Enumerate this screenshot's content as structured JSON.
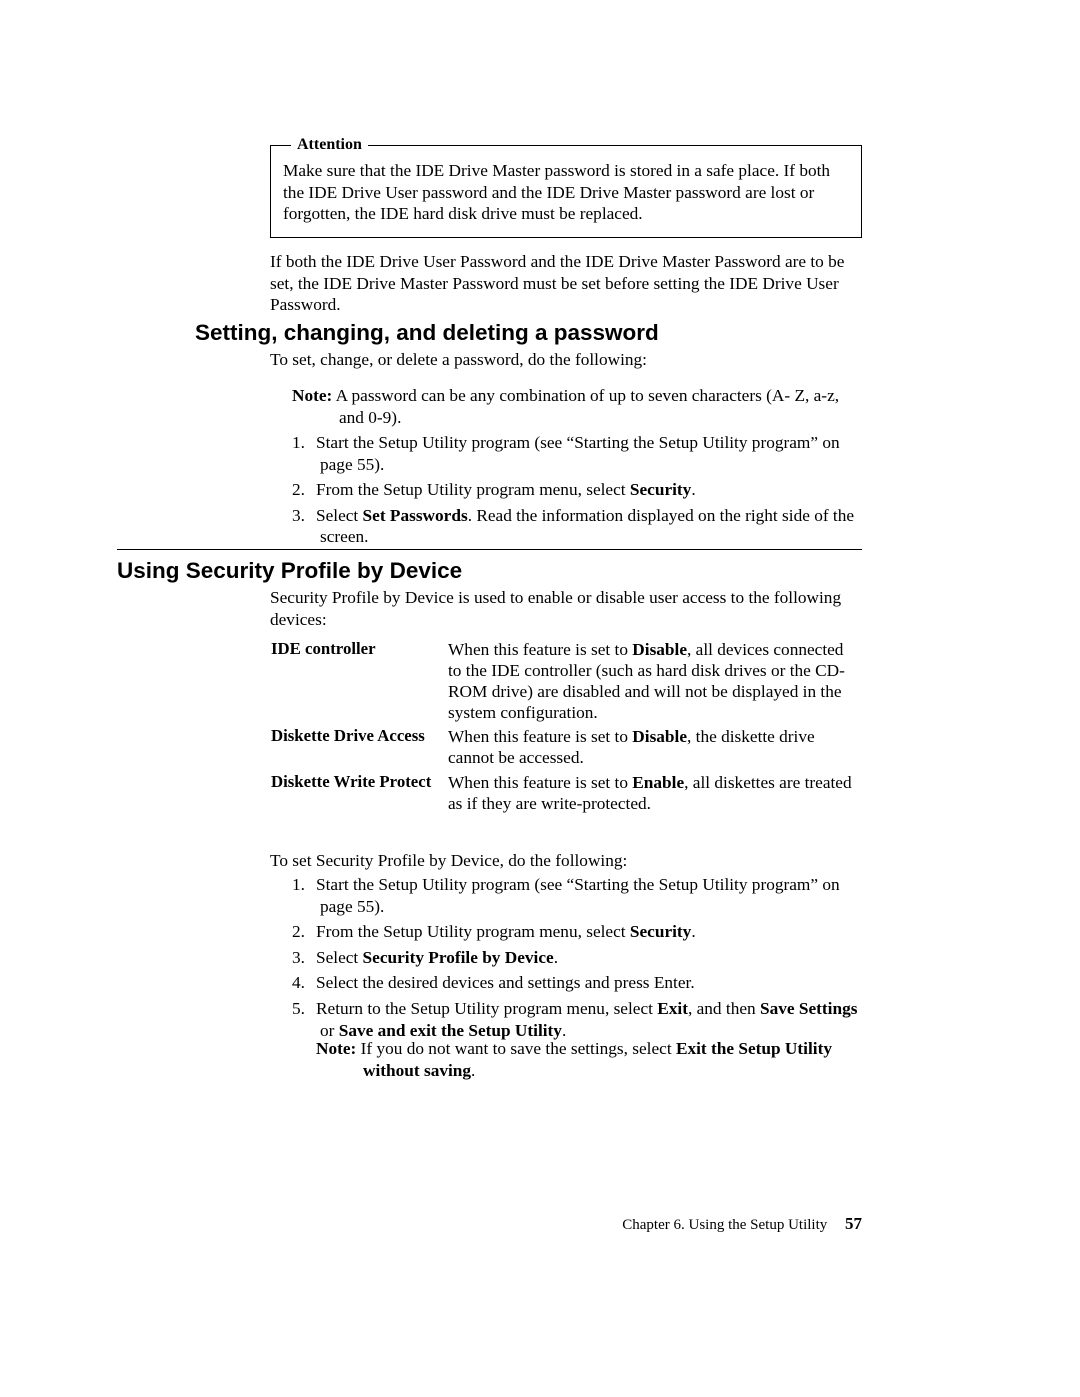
{
  "attention": {
    "label": "Attention",
    "body": "Make sure that the IDE Drive Master password is stored in a safe place. If both the IDE Drive User password and the IDE Drive Master password are lost or forgotten, the IDE hard disk drive must be replaced."
  },
  "para_after_box": "If both the IDE Drive User Password and the IDE Drive Master Password are to be set, the IDE Drive Master Password must be set before setting the IDE Drive User Password.",
  "setting": {
    "heading": "Setting, changing, and deleting a password",
    "intro": "To set, change, or delete a password, do the following:",
    "note_label": "Note:",
    "note_body": " A password can be any combination of up to seven characters (A- Z, a-z, and 0-9).",
    "steps": {
      "s1_pre": "Start the Setup Utility program (see “Starting the Setup Utility program” on page 55).",
      "s2_pre": "From the Setup Utility program menu, select ",
      "s2_bold": "Security",
      "s2_post": ".",
      "s3_pre": "Select ",
      "s3_bold": "Set Passwords",
      "s3_post": ". Read the information displayed on the right side of the screen."
    }
  },
  "using": {
    "heading": "Using Security Profile by Device",
    "intro": "Security Profile by Device is used to enable or disable user access to the following devices:",
    "rows": {
      "r1_label": "IDE controller",
      "r1_pre": "When this feature is set to ",
      "r1_bold": "Disable",
      "r1_post": ", all devices connected to the IDE controller (such as hard disk drives or the CD-ROM drive) are disabled and will not be displayed in the system configuration.",
      "r2_label": "Diskette Drive Access",
      "r2_pre": "When this feature is set to ",
      "r2_bold": "Disable",
      "r2_post": ", the diskette drive cannot be accessed.",
      "r3_label": "Diskette Write Protect",
      "r3_pre": "When this feature is set to ",
      "r3_bold": "Enable",
      "r3_post": ", all diskettes are treated as if they are write-protected."
    },
    "to_set": "To set Security Profile by Device, do the following:",
    "steps": {
      "s1": "Start the Setup Utility program (see “Starting the Setup Utility program” on page 55).",
      "s2_pre": "From the Setup Utility program menu, select ",
      "s2_bold": "Security",
      "s2_post": ".",
      "s3_pre": "Select ",
      "s3_bold": "Security Profile by Device",
      "s3_post": ".",
      "s4": "Select the desired devices and settings and press Enter.",
      "s5_pre": "Return to the Setup Utility program menu, select ",
      "s5_b1": "Exit",
      "s5_mid": ", and then ",
      "s5_b2": "Save Settings",
      "s5_or": " or ",
      "s5_b3": "Save and exit the Setup Utility",
      "s5_post": "."
    },
    "note2_label": "Note:",
    "note2_pre": " If you do not want to save the settings, select ",
    "note2_b1": "Exit the Setup Utility without saving",
    "note2_post": "."
  },
  "footer": {
    "chapter": "Chapter 6. Using the Setup Utility",
    "page": "57"
  }
}
